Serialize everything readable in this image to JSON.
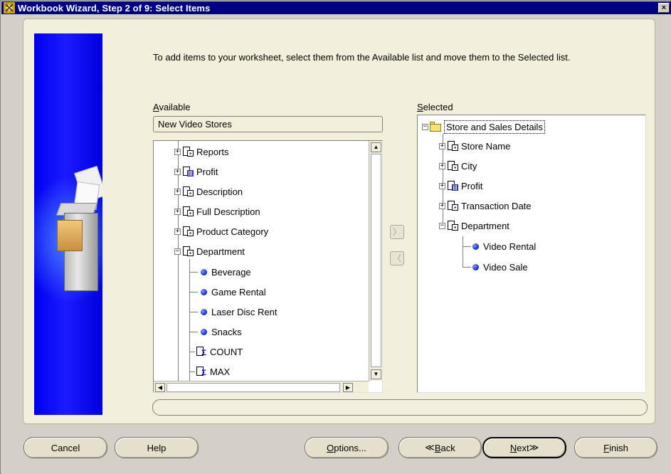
{
  "window": {
    "title": "Workbook Wizard, Step 2 of 9: Select Items",
    "close_label": "×"
  },
  "instructions": "To add items to your worksheet, select them from the Available list and move them to the Selected list.",
  "available": {
    "label_mnemonic": "A",
    "label_rest": "vailable",
    "business_area": "New Video Stores",
    "items": [
      {
        "label": "Reports",
        "expander": "+",
        "icon": "item-icon"
      },
      {
        "label": "Profit",
        "expander": "+",
        "icon": "measure-icon"
      },
      {
        "label": "Description",
        "expander": "+",
        "icon": "item-icon"
      },
      {
        "label": "Full Description",
        "expander": "+",
        "icon": "item-icon"
      },
      {
        "label": "Product Category",
        "expander": "+",
        "icon": "item-icon"
      },
      {
        "label": "Department",
        "expander": "−",
        "icon": "item-icon"
      },
      {
        "label": "Beverage",
        "icon": "value-bullet"
      },
      {
        "label": "Game Rental",
        "icon": "value-bullet"
      },
      {
        "label": "Laser Disc Rent",
        "icon": "value-bullet"
      },
      {
        "label": "Snacks",
        "icon": "value-bullet"
      },
      {
        "label": "COUNT",
        "icon": "sigma-icon"
      },
      {
        "label": "MAX",
        "icon": "sigma-icon"
      }
    ]
  },
  "selected": {
    "label_mnemonic": "S",
    "label_rest": "elected",
    "root": "Store and Sales Details",
    "items": [
      {
        "label": "Store Name",
        "expander": "+",
        "icon": "item-icon"
      },
      {
        "label": "City",
        "expander": "+",
        "icon": "item-icon"
      },
      {
        "label": "Profit",
        "expander": "+",
        "icon": "measure-icon"
      },
      {
        "label": "Transaction Date",
        "expander": "+",
        "icon": "item-icon"
      },
      {
        "label": "Department",
        "expander": "−",
        "icon": "item-icon"
      },
      {
        "label": "Video Rental",
        "icon": "value-bullet"
      },
      {
        "label": "Video Sale",
        "icon": "value-bullet"
      }
    ]
  },
  "move_buttons": {
    "add": "〉",
    "remove": "〈"
  },
  "buttons": {
    "cancel": "Cancel",
    "help": "Help",
    "options_mnemonic": "O",
    "options_rest": "ptions...",
    "back_prefix": "≪ ",
    "back_mnemonic": "B",
    "back_rest": "ack",
    "next_mnemonic": "N",
    "next_rest": "ext",
    "next_suffix": " ≫",
    "finish_mnemonic": "F",
    "finish_rest": "inish"
  },
  "colors": {
    "titlebar": "#000080",
    "panel": "#f2efda",
    "side_image": "#0000ee",
    "bullet": "#1a2fd6"
  }
}
